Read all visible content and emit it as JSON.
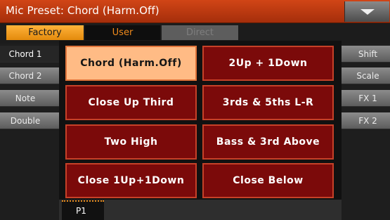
{
  "header": {
    "title": "Mic Preset: Chord (Harm.Off)"
  },
  "tabs": [
    {
      "label": "Factory",
      "state": "active"
    },
    {
      "label": "User",
      "state": "inactive"
    },
    {
      "label": "Direct",
      "state": "disabled"
    }
  ],
  "left_tabs": [
    {
      "label": "Chord 1",
      "active": true
    },
    {
      "label": "Chord 2",
      "active": false
    },
    {
      "label": "Note",
      "active": false
    },
    {
      "label": "Double",
      "active": false
    }
  ],
  "right_tabs": [
    {
      "label": "Shift"
    },
    {
      "label": "Scale"
    },
    {
      "label": "FX 1"
    },
    {
      "label": "FX 2"
    }
  ],
  "presets": [
    {
      "label": "Chord (Harm.Off)",
      "selected": true
    },
    {
      "label": "2Up + 1Down",
      "selected": false
    },
    {
      "label": "Close Up Third",
      "selected": false
    },
    {
      "label": "3rds & 5ths L-R",
      "selected": false
    },
    {
      "label": "Two High",
      "selected": false
    },
    {
      "label": "Bass & 3rd Above",
      "selected": false
    },
    {
      "label": "Close 1Up+1Down",
      "selected": false
    },
    {
      "label": "Close Below",
      "selected": false
    }
  ],
  "page": {
    "label": "P1"
  },
  "colors": {
    "title_bar": "#c13b12",
    "accent_orange": "#f5a020",
    "preset_button": "#7b0a0a",
    "preset_selected": "#ffbb85"
  },
  "icons": {
    "menu": "dropdown-arrow-icon"
  }
}
